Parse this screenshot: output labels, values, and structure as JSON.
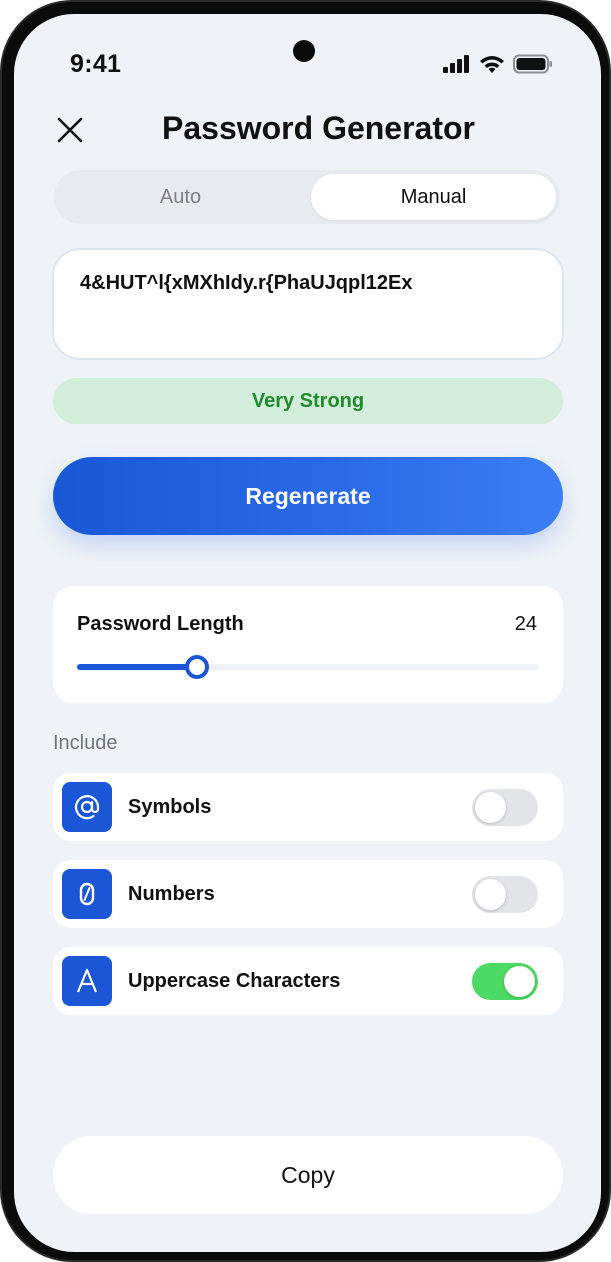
{
  "status_bar": {
    "time": "9:41",
    "icons": [
      "signal-icon",
      "wifi-icon",
      "battery-icon"
    ]
  },
  "header": {
    "title": "Password Generator",
    "close_icon": "close-icon"
  },
  "mode_tabs": {
    "tabs": [
      {
        "label": "Auto",
        "selected": false
      },
      {
        "label": "Manual",
        "selected": true
      }
    ]
  },
  "password": {
    "value": "4&HUT^l{xMXhIdy.r{PhaUJqpl12Ex"
  },
  "strength": {
    "label": "Very Strong",
    "color": "#1e8b2c",
    "background": "#d3eddb"
  },
  "regenerate": {
    "label": "Regenerate"
  },
  "length": {
    "label": "Password Length",
    "value": "24",
    "slider_fraction": 0.26
  },
  "include": {
    "heading": "Include",
    "options": [
      {
        "icon": "at-sign-icon",
        "glyph": "@",
        "label": "Symbols",
        "enabled": false
      },
      {
        "icon": "zero-digit-icon",
        "glyph": "0",
        "label": "Numbers",
        "enabled": false
      },
      {
        "icon": "letter-a-icon",
        "glyph": "A",
        "label": "Uppercase Characters",
        "enabled": true
      }
    ]
  },
  "copy": {
    "label": "Copy"
  },
  "colors": {
    "accent": "#1a56d6",
    "toggle_on": "#4cd964",
    "toggle_off": "#e2e4e7",
    "background": "#eff3f7"
  }
}
